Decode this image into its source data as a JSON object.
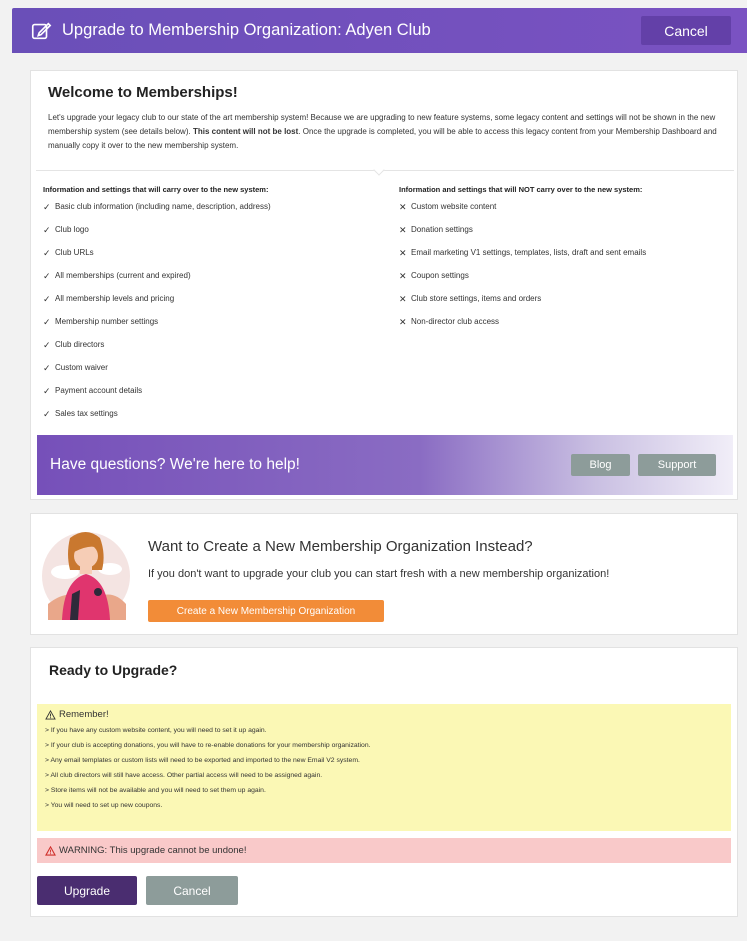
{
  "header": {
    "title": "Upgrade to Membership Organization: Adyen Club",
    "cancel_label": "Cancel",
    "icon": "edit-icon"
  },
  "welcome": {
    "title": "Welcome to Memberships!",
    "text_before_bold": "Let's upgrade your legacy club to our state of the art membership system! Because we are upgrading to new feature systems, some legacy content and settings will not be shown in the new membership system (see details below). ",
    "text_bold": "This content will not be lost",
    "text_after_bold": ". Once the upgrade is completed, you will be able to access this legacy content from your Membership Dashboard and manually copy it over to the new membership system."
  },
  "carry_over": {
    "heading": "Information and settings that will carry over to the new system:",
    "mark": "✓",
    "items": [
      "Basic club information (including name, description, address)",
      "Club logo",
      "Club URLs",
      "All memberships (current and expired)",
      "All membership levels and pricing",
      "Membership number settings",
      "Club directors",
      "Custom waiver",
      "Payment account details",
      "Sales tax settings"
    ]
  },
  "not_carry_over": {
    "heading": "Information and settings that will NOT carry over to the new system:",
    "mark": "✕",
    "items": [
      "Custom website content",
      "Donation settings",
      "Email marketing V1 settings, templates, lists, draft and sent emails",
      "Coupon settings",
      "Club store settings, items and orders",
      "Non-director club access"
    ]
  },
  "help": {
    "text": "Have questions? We're here to help!",
    "blog_label": "Blog",
    "support_label": "Support"
  },
  "new_org": {
    "title": "Want to Create a New Membership Organization Instead?",
    "description": "If you don't want to upgrade your club you can start fresh with a new membership organization!",
    "button_label": "Create a New Membership Organization"
  },
  "ready": {
    "title": "Ready to Upgrade?",
    "remember_title": "Remember!",
    "remember_items": [
      "> If you have any custom website content, you will need to set it up again.",
      "> If your club is accepting donations, you will have to re-enable donations for your membership organization.",
      "> Any email templates or custom lists will need to be exported and imported to the new Email V2 system.",
      "> All club directors will still have access. Other partial access will need to be assigned again.",
      "> Store items will not be available and you will need to set them up again.",
      "> You will need to set up new coupons."
    ],
    "warning_text": "WARNING: This upgrade cannot be undone!",
    "upgrade_label": "Upgrade",
    "cancel_label": "Cancel"
  },
  "colors": {
    "header": "#6a4fb8",
    "upgrade_button": "#4a2d70",
    "grey_button": "#8d9c9a",
    "create_button": "#f28c38",
    "remember_bg": "#fbf8b5",
    "warning_bg": "#f9c9c9"
  }
}
